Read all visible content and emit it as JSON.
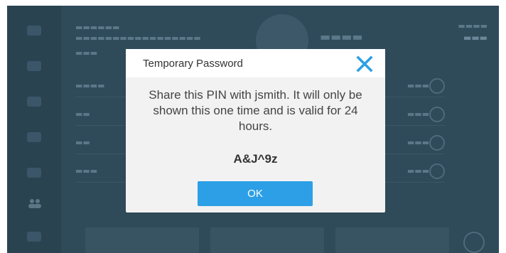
{
  "dialog": {
    "title": "Temporary Password",
    "message": "Share this PIN with jsmith. It will only be shown this one time and is valid for 24 hours.",
    "pin": "A&J^9z",
    "ok_label": "OK",
    "close_icon": "close-icon"
  },
  "colors": {
    "accent": "#2d9fe6",
    "overlay": "#2f4a59",
    "dialog_background": "#f2f2f2"
  }
}
